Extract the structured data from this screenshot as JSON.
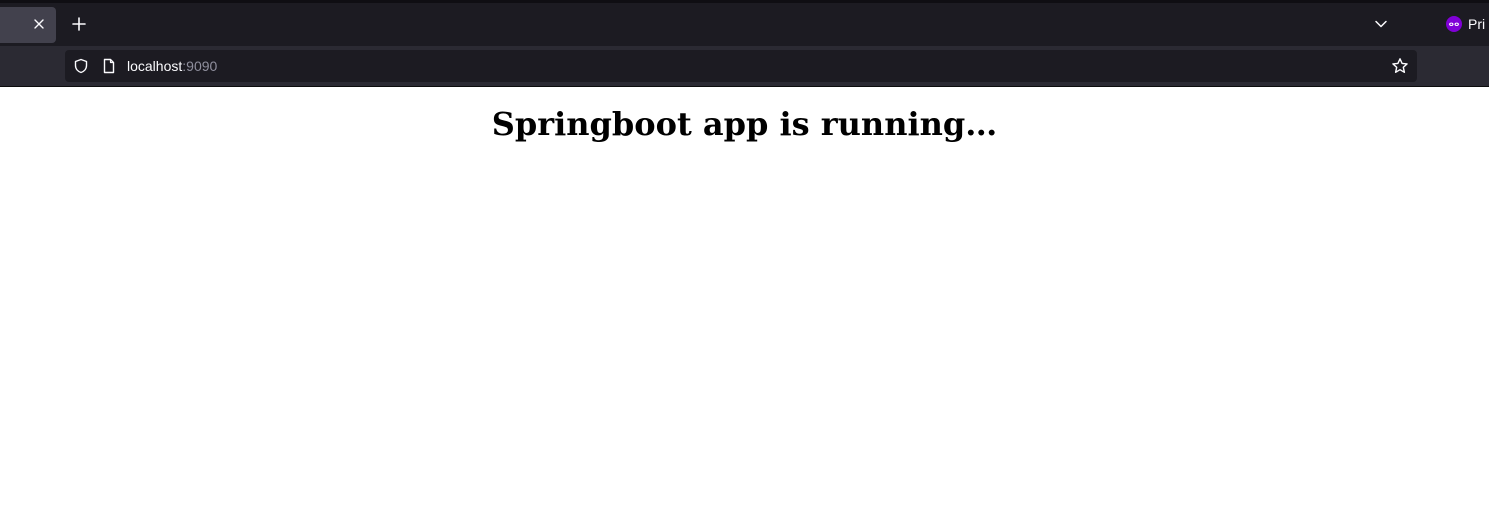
{
  "browser": {
    "private_label": "Pri",
    "address": {
      "host": "localhost",
      "port": ":9090"
    },
    "icons": {
      "tab_close": "close-icon",
      "new_tab": "plus-icon",
      "tab_list": "chevron-down-icon",
      "private": "private-browsing-icon",
      "tracking_protection": "shield-icon",
      "page_info": "page-icon",
      "bookmark": "star-icon"
    },
    "colors": {
      "chrome_background": "#1c1b22",
      "nav_background": "#2b2a33",
      "active_tab": "#42414d",
      "private_accent": "#8000d7"
    }
  },
  "page": {
    "heading": "Springboot app is running…"
  }
}
